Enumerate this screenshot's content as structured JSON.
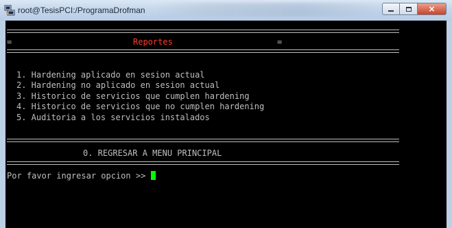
{
  "window": {
    "title": "root@TesisPCI:/ProgramaDrofman",
    "icon": "putty-icon",
    "buttons": {
      "minimize": "minimize-icon",
      "maximize": "maximize-icon",
      "close": "×"
    }
  },
  "terminal": {
    "header_left": "=",
    "header_title": "Reportes",
    "header_right": "=",
    "options": [
      "1. Hardening aplicado en sesion actual",
      "2. Hardening no aplicado en sesion actual",
      "3. Historico de servicios que cumplen hardening",
      "4. Historico de servicios que no cumplen hardening",
      "5. Auditoria a los servicios instalados"
    ],
    "back_option": "0. REGRESAR A MENU PRINCIPAL",
    "prompt": "Por favor ingresar opcion >> ",
    "colors": {
      "background": "#000000",
      "text": "#bfbfbf",
      "title": "#ff3b2f",
      "cursor": "#00ff00"
    }
  }
}
